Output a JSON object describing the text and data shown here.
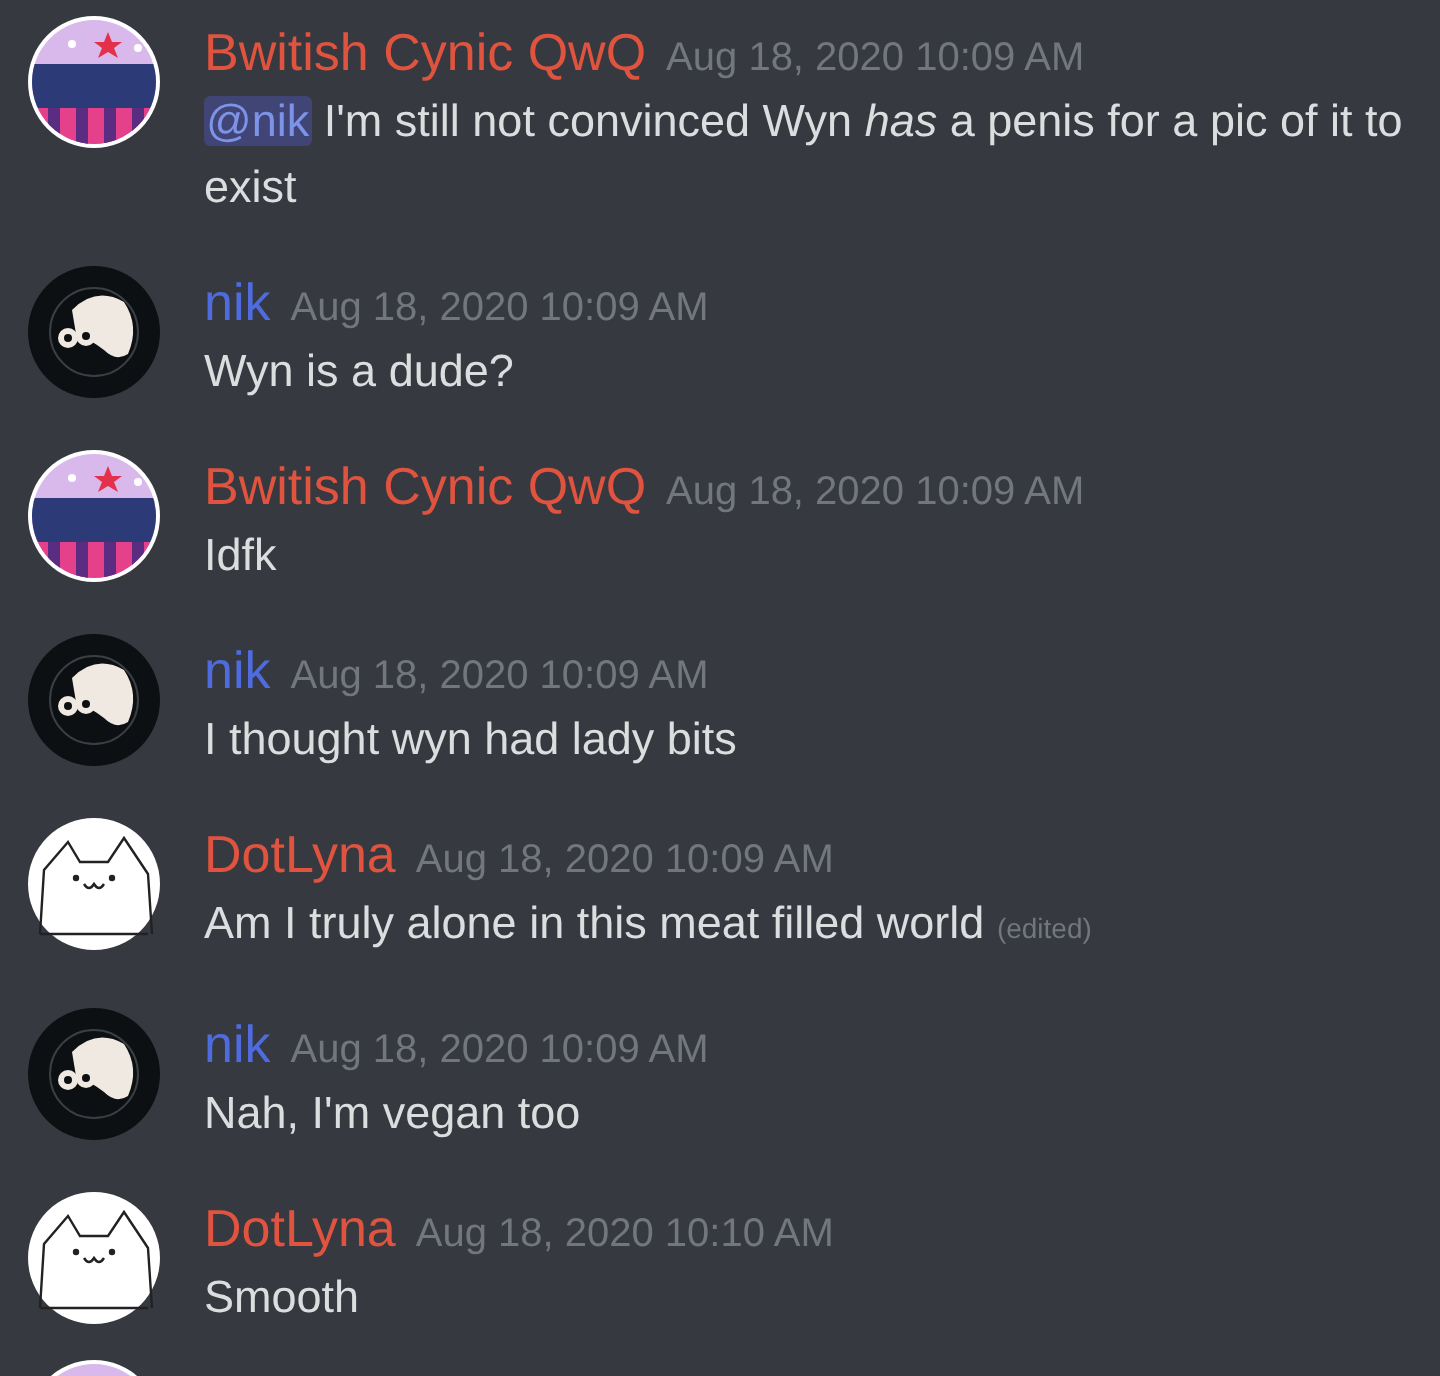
{
  "messages": [
    {
      "author": "Bwitish Cynic QwQ",
      "color": "#e0533f",
      "avatar": {
        "kind": "badge"
      },
      "time": "Aug 18, 2020 10:09 AM",
      "mention": "@nik",
      "text": "I'm still not convinced Wyn *has* a penis for a pic of it to exist"
    },
    {
      "author": "nik",
      "color": "#4e6ce0",
      "avatar": {
        "kind": "blob"
      },
      "time": "Aug 18, 2020 10:09 AM",
      "text": "Wyn is a dude?"
    },
    {
      "author": "Bwitish Cynic QwQ",
      "color": "#e0533f",
      "avatar": {
        "kind": "badge"
      },
      "time": "Aug 18, 2020 10:09 AM",
      "text": "Idfk"
    },
    {
      "author": "nik",
      "color": "#4e6ce0",
      "avatar": {
        "kind": "blob"
      },
      "time": "Aug 18, 2020 10:09 AM",
      "text": "I thought wyn had lady bits"
    },
    {
      "author": "DotLyna",
      "color": "#e0533f",
      "avatar": {
        "kind": "cat"
      },
      "time": "Aug 18, 2020 10:09 AM",
      "text": "Am I truly alone in this meat filled world",
      "edited_label": "(edited)"
    },
    {
      "author": "nik",
      "color": "#4e6ce0",
      "avatar": {
        "kind": "blob"
      },
      "time": "Aug 18, 2020 10:09 AM",
      "text": "Nah, I'm vegan too"
    },
    {
      "author": "DotLyna",
      "color": "#e0533f",
      "avatar": {
        "kind": "cat"
      },
      "time": "Aug 18, 2020 10:10 AM",
      "text": "Smooth"
    }
  ],
  "next_avatar": {
    "kind": "badge"
  }
}
